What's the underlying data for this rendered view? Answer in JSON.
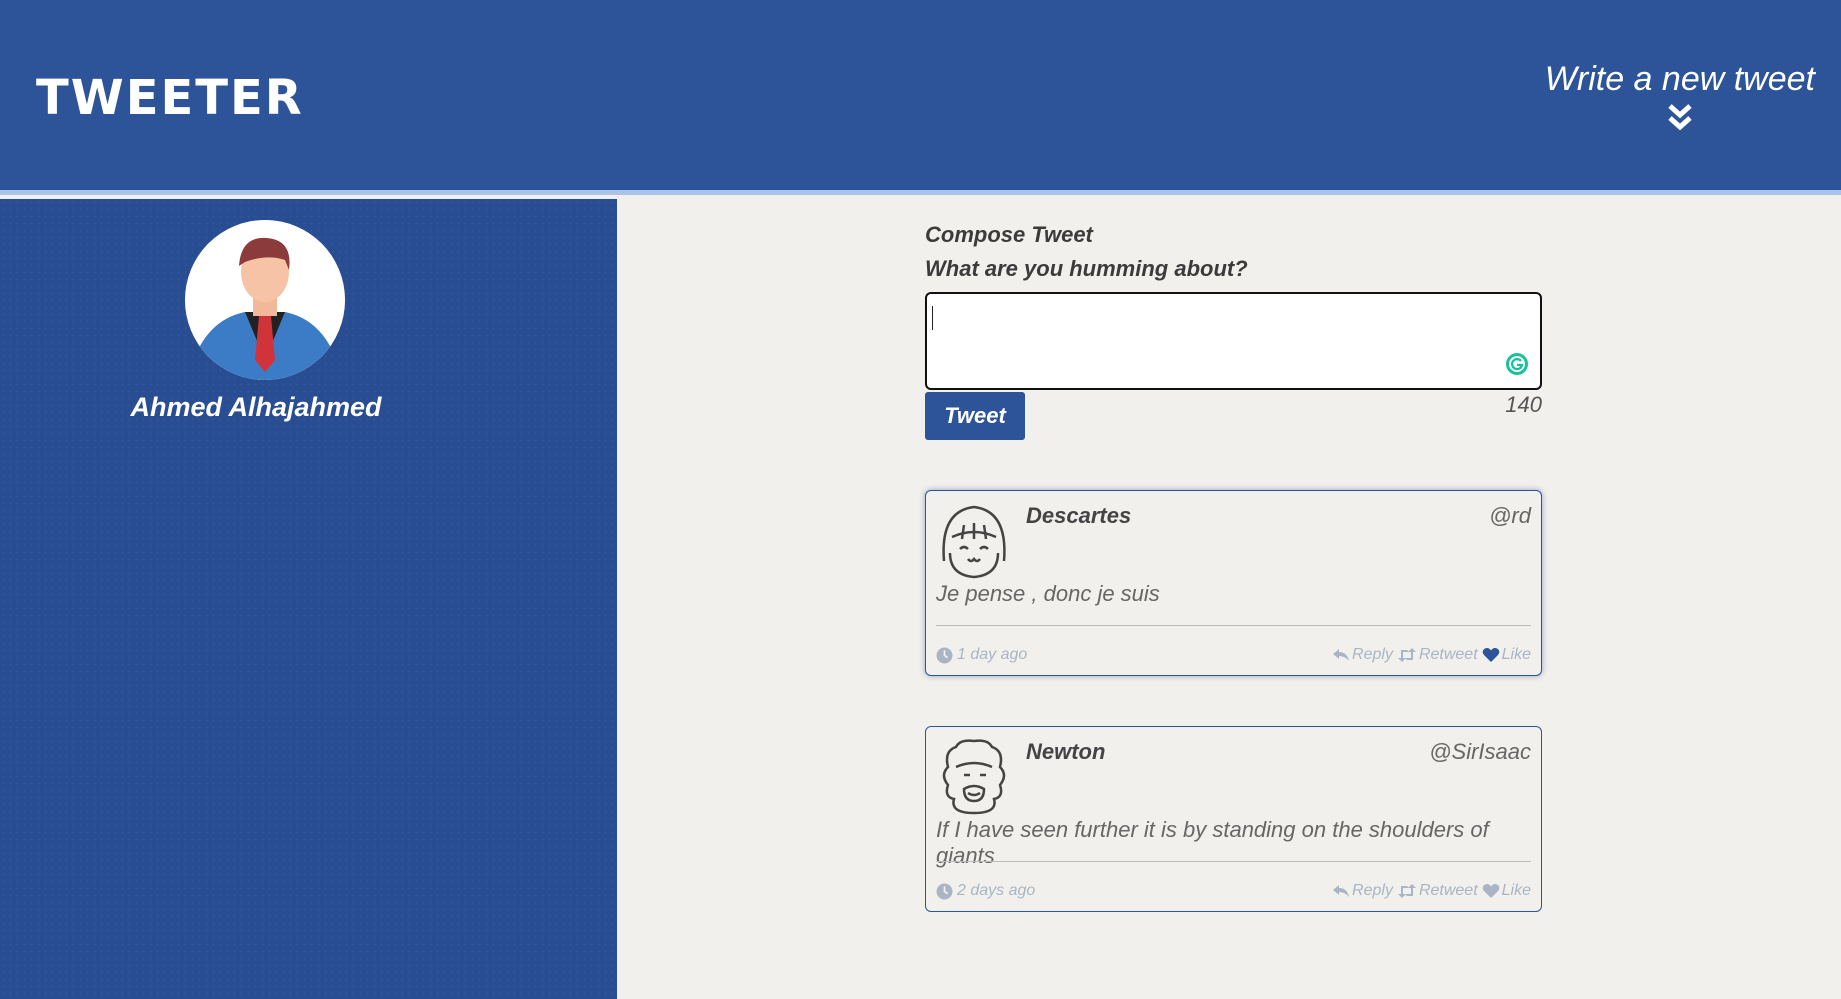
{
  "header": {
    "logo": "TWEETER",
    "write_toggle_label": "Write a new tweet"
  },
  "profile": {
    "name": "Ahmed Alhajahmed"
  },
  "compose": {
    "title": "Compose Tweet",
    "prompt": "What are you humming about?",
    "text_value": "",
    "button_label": "Tweet",
    "char_counter": "140"
  },
  "tweets": [
    {
      "author": "Descartes",
      "handle": "@rd",
      "body": "Je pense , donc je suis",
      "time": "1 day ago",
      "reply_label": "Reply",
      "retweet_label": "Retweet",
      "like_label": "Like",
      "liked": true
    },
    {
      "author": "Newton",
      "handle": "@SirIsaac",
      "body": "If I have seen further it is by standing on the shoulders of giants",
      "time": "2 days ago",
      "reply_label": "Reply",
      "retweet_label": "Retweet",
      "like_label": "Like",
      "liked": false
    }
  ],
  "colors": {
    "brand_blue": "#2d5499",
    "sidebar_blue": "#284d92",
    "page_bg": "#f2f0ec",
    "footer_grey": "#a9b5c5",
    "liked_blue": "#2d5499"
  }
}
